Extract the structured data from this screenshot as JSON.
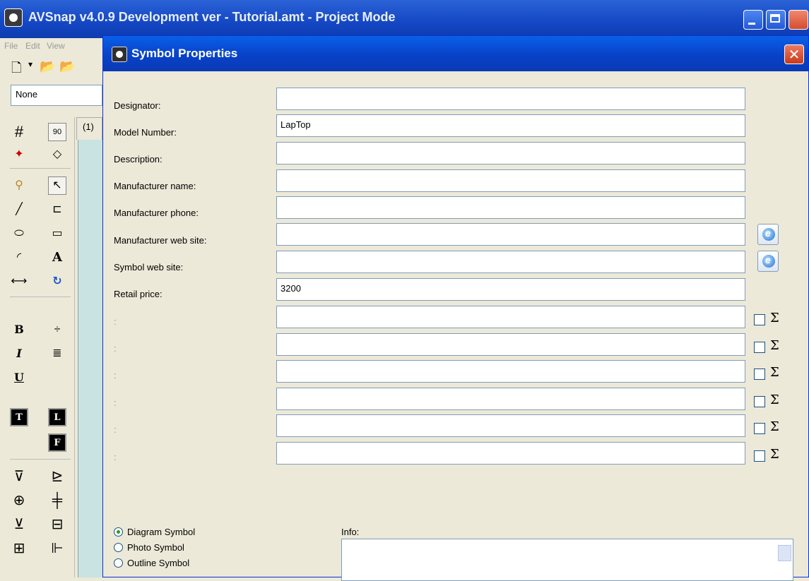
{
  "main_window": {
    "title": "AVSnap v4.0.9 Development ver - Tutorial.amt - Project Mode",
    "menu": [
      "File",
      "Edit",
      "View"
    ],
    "combo_value": "None",
    "tab_label": "(1)"
  },
  "toolbox": {
    "grid_button": "#",
    "rotate_label": "90",
    "text_button": "A",
    "bold_button": "B",
    "italic_button": "I",
    "underline_button": "U",
    "t_button": "T",
    "l_button": "L",
    "f_button": "F"
  },
  "dialog": {
    "title": "Symbol Properties",
    "close_glyph": "✕",
    "fields": [
      {
        "label": "Designator:",
        "value": ""
      },
      {
        "label": "Model Number:",
        "value": "LapTop"
      },
      {
        "label": "Description:",
        "value": ""
      },
      {
        "label": "Manufacturer name:",
        "value": ""
      },
      {
        "label": "Manufacturer phone:",
        "value": ""
      },
      {
        "label": "Manufacturer web site:",
        "value": ""
      },
      {
        "label": "Symbol web site:",
        "value": ""
      },
      {
        "label": "Retail price:",
        "value": "3200"
      }
    ],
    "custom_fields": [
      {
        "label": ":",
        "value": "",
        "checked": false
      },
      {
        "label": ":",
        "value": "",
        "checked": false
      },
      {
        "label": ":",
        "value": "",
        "checked": false
      },
      {
        "label": ":",
        "value": "",
        "checked": false
      },
      {
        "label": ":",
        "value": "",
        "checked": false
      },
      {
        "label": ":",
        "value": "",
        "checked": false
      }
    ],
    "sigma_glyph": "Σ",
    "symbol_types": [
      {
        "label": "Diagram Symbol",
        "selected": true
      },
      {
        "label": "Photo Symbol",
        "selected": false
      },
      {
        "label": "Outline Symbol",
        "selected": false
      }
    ],
    "info_label": "Info:",
    "info_value": ""
  }
}
